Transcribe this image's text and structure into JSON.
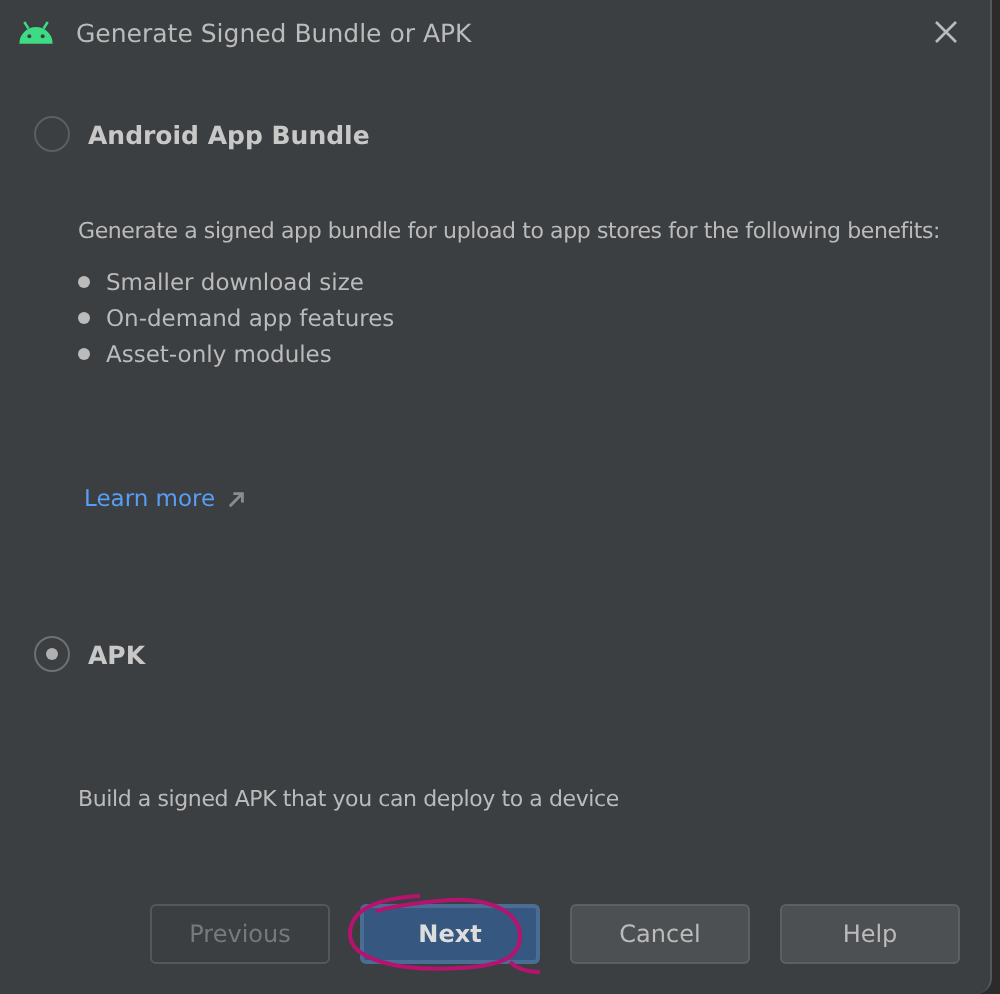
{
  "window": {
    "title": "Generate Signed Bundle or APK"
  },
  "options": [
    {
      "label": "Android App Bundle",
      "selected": false,
      "description": "Generate a signed app bundle for upload to app stores for the following benefits:",
      "bullets": [
        "Smaller download size",
        "On-demand app features",
        "Asset-only modules"
      ],
      "link": "Learn more"
    },
    {
      "label": "APK",
      "selected": true,
      "description": "Build a signed APK that you can deploy to a device"
    }
  ],
  "buttons": [
    {
      "label": "Previous",
      "disabled": true,
      "default": false,
      "circled": false
    },
    {
      "label": "Next",
      "disabled": false,
      "default": true,
      "circled": true
    },
    {
      "label": "Cancel",
      "disabled": false,
      "default": false,
      "circled": false
    },
    {
      "label": "Help",
      "disabled": false,
      "default": false,
      "circled": false
    }
  ]
}
